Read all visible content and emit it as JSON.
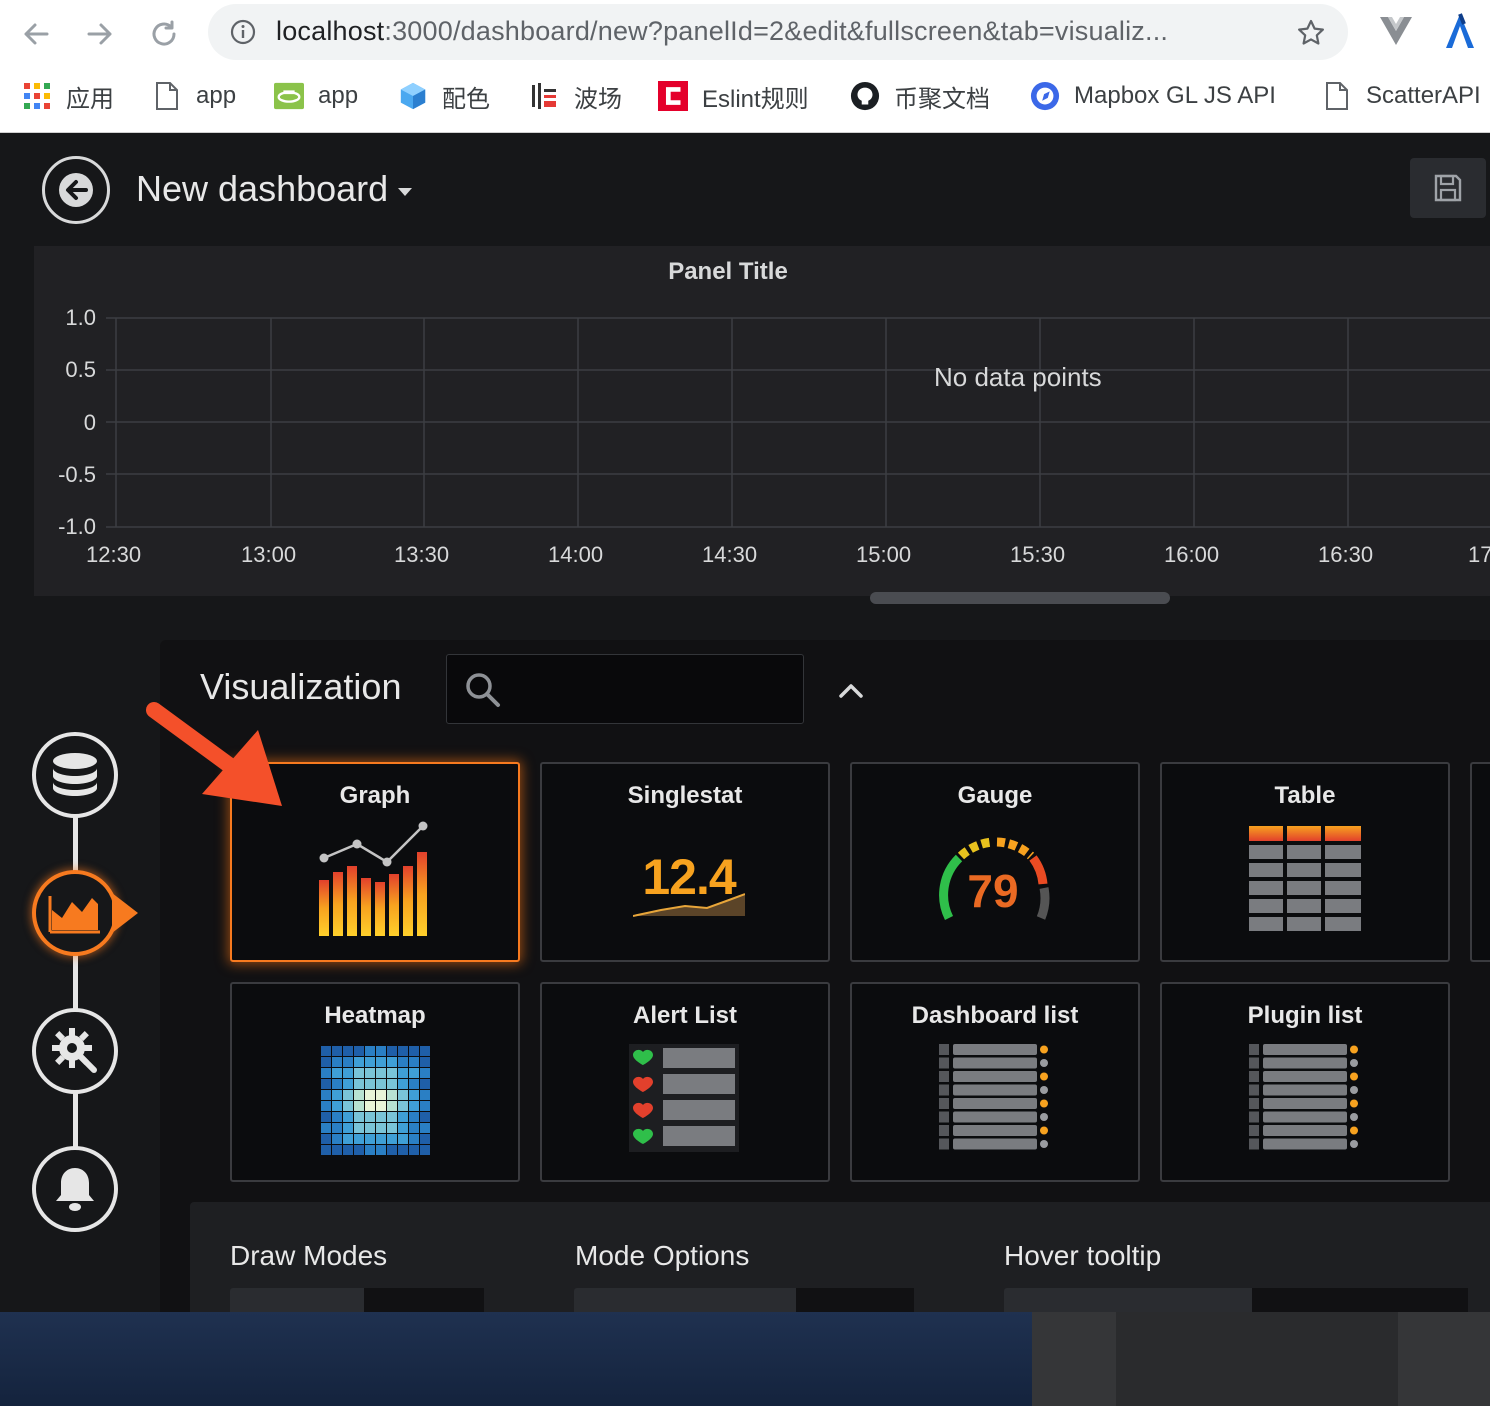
{
  "browser": {
    "url_host": "localhost",
    "url_path": ":3000/dashboard/new?panelId=2&edit&fullscreen&tab=visualiz...",
    "bookmarks": [
      {
        "label": "应用",
        "icon": "apps-grid-icon"
      },
      {
        "label": "app",
        "icon": "page-icon"
      },
      {
        "label": "app",
        "icon": "app-logo-icon"
      },
      {
        "label": "配色",
        "icon": "color-cube-icon"
      },
      {
        "label": "波场",
        "icon": "tron-icon"
      },
      {
        "label": "Eslint规则",
        "icon": "eslint-icon"
      },
      {
        "label": "币聚文档",
        "icon": "github-icon"
      },
      {
        "label": "Mapbox GL JS API",
        "icon": "mapbox-icon"
      },
      {
        "label": "ScatterAPI",
        "icon": "page-icon"
      }
    ]
  },
  "header": {
    "title": "New dashboard"
  },
  "panel": {
    "title": "Panel Title",
    "empty_message": "No data points",
    "y_ticks": [
      "1.0",
      "0.5",
      "0",
      "-0.5",
      "-1.0"
    ],
    "x_ticks": [
      "12:30",
      "13:00",
      "13:30",
      "14:00",
      "14:30",
      "15:00",
      "15:30",
      "16:00",
      "16:30",
      "17"
    ]
  },
  "visualization": {
    "title": "Visualization",
    "search_placeholder": "",
    "cards": [
      {
        "label": "Graph",
        "selected": true
      },
      {
        "label": "Singlestat",
        "selected": false,
        "value": "12.4"
      },
      {
        "label": "Gauge",
        "selected": false,
        "value": "79"
      },
      {
        "label": "Table",
        "selected": false
      },
      {
        "label": "Heatmap",
        "selected": false
      },
      {
        "label": "Alert List",
        "selected": false
      },
      {
        "label": "Dashboard list",
        "selected": false
      },
      {
        "label": "Plugin list",
        "selected": false
      }
    ]
  },
  "options": {
    "sections": [
      "Draw Modes",
      "Mode Options",
      "Hover tooltip"
    ]
  },
  "colors": {
    "accent": "#f77a1f",
    "background": "#161719",
    "panel": "#212124"
  }
}
